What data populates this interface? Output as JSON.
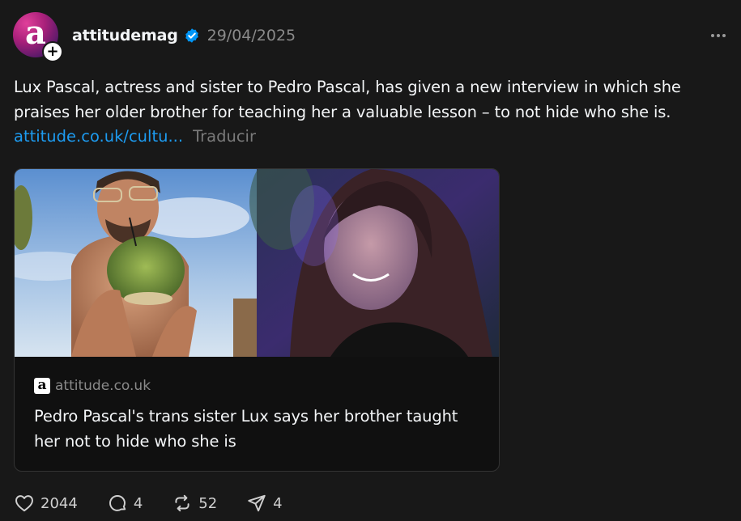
{
  "post": {
    "avatar_letter": "a",
    "follow_badge": "+",
    "username": "attitudemag",
    "verified_icon": "verified-badge-icon",
    "date": "29/04/2025",
    "more_icon": "more-options-icon",
    "text": "Lux Pascal, actress and sister to Pedro Pascal, has given a new interview in which she praises her older brother for teaching her a valuable lesson – to not hide who she is.",
    "link": "attitude.co.uk/cultu...",
    "translate": "Traducir"
  },
  "card": {
    "site_logo_letter": "a",
    "domain": "attitude.co.uk",
    "title": "Pedro Pascal's trans sister Lux says her brother taught her not to hide who she is"
  },
  "actions": {
    "likes": "2044",
    "comments": "4",
    "reposts": "52",
    "shares": "4"
  },
  "colors": {
    "background": "#181818",
    "link": "#1d9bf0",
    "verified": "#0095f6",
    "muted": "#8a8a8a"
  }
}
